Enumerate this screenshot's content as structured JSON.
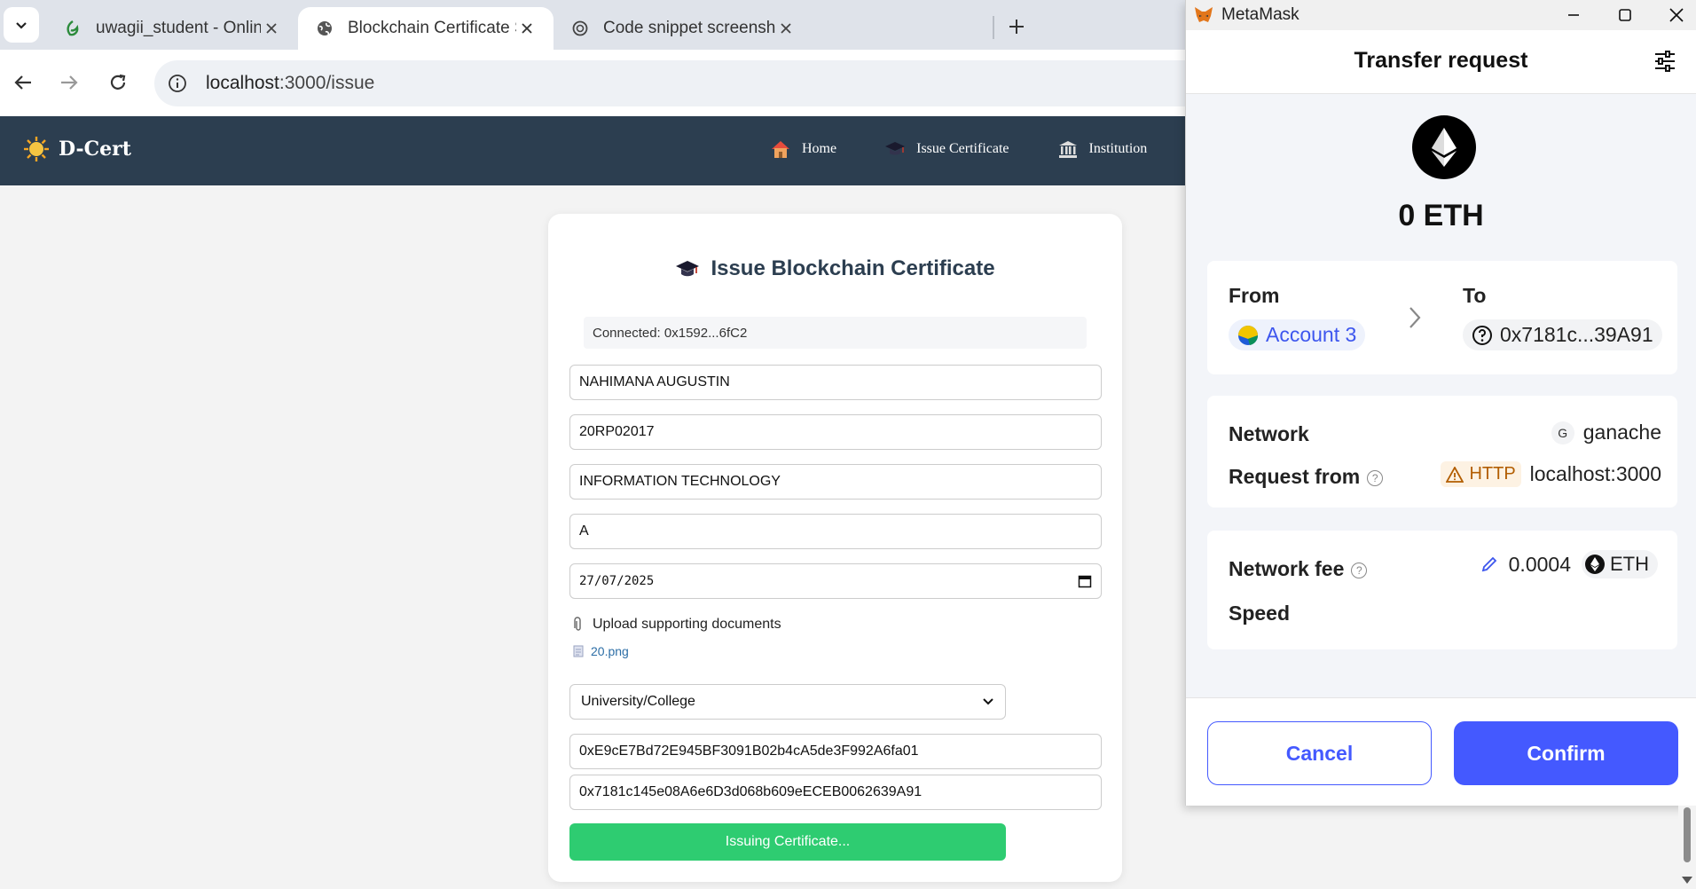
{
  "browser": {
    "tabs": [
      {
        "title": "uwagii_student - Online LaTeX E",
        "icon": "overleaf-icon"
      },
      {
        "title": "Blockchain Certificate System",
        "icon": "globe-icon"
      },
      {
        "title": "Code snippet screenshot",
        "icon": "openai-icon"
      }
    ],
    "url_host": "localhost",
    "url_path": ":3000/issue"
  },
  "navbar": {
    "brand": "D-Cert",
    "links": [
      "Home",
      "Issue Certificate",
      "Institution"
    ]
  },
  "form": {
    "title": "Issue Blockchain Certificate",
    "connected": "Connected: 0x1592...6fC2",
    "student_name": "NAHIMANA AUGUSTIN",
    "reg_number": "20RP02017",
    "department": "INFORMATION TECHNOLOGY",
    "grade": "A",
    "date": "27/07/2025",
    "upload_label": "Upload supporting documents",
    "upload_file": "20.png",
    "institution_type": "University/College",
    "issuer_address": "0xE9cE7Bd72E945BF3091B02b4cA5de3F992A6fa01",
    "recipient_address": "0x7181c145e08A6e6D3d068b609eECEB0062639A91",
    "submit_label": "Issuing Certificate..."
  },
  "metamask": {
    "app_name": "MetaMask",
    "header_title": "Transfer request",
    "amount": "0 ETH",
    "from_label": "From",
    "to_label": "To",
    "from_account": "Account 3",
    "to_address": "0x7181c...39A91",
    "network_label": "Network",
    "network_badge": "G",
    "network_value": "ganache",
    "request_from_label": "Request from",
    "http_badge": "HTTP",
    "request_from_value": "localhost:3000",
    "fee_label": "Network fee",
    "fee_value": "0.0004",
    "fee_unit": "ETH",
    "speed_label": "Speed",
    "cancel_label": "Cancel",
    "confirm_label": "Confirm"
  },
  "colors": {
    "navbar": "#2c3e50",
    "submit": "#2ecc71",
    "metamask_accent": "#4459ff"
  }
}
